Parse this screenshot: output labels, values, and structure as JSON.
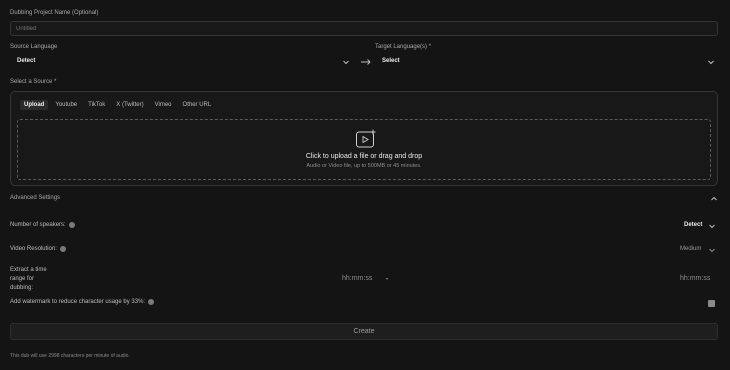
{
  "project_name": {
    "label": "Dubbing Project Name (Optional)",
    "placeholder": "Untitled"
  },
  "source_language": {
    "label": "Source Language",
    "value": "Detect"
  },
  "target_languages": {
    "label": "Target Language(s) *",
    "value": "Select"
  },
  "source": {
    "label": "Select a Source *",
    "tabs": [
      "Upload",
      "Youtube",
      "TikTok",
      "X (Twitter)",
      "Vimeo",
      "Other URL"
    ],
    "upload": {
      "title": "Click to upload a file or drag and drop",
      "subtitle": "Audio or Video file, up to 500MB or 45 minutes."
    }
  },
  "advanced": {
    "title": "Advanced Settings",
    "speakers": {
      "label": "Number of speakers:",
      "value": "Detect"
    },
    "resolution": {
      "label": "Video Resolution:",
      "value": "Medium"
    },
    "time_range": {
      "label_lines": [
        "Extract a time",
        "range for",
        "dubbing:"
      ],
      "start": "hh:mm:ss",
      "end": "hh:mm:ss"
    },
    "watermark": {
      "label": "Add watermark to reduce character usage by 33%:",
      "checked": false
    }
  },
  "create_label": "Create",
  "footer_note": "This dub will use 2998 characters per minute of audio.",
  "colors": {
    "background": "#141414",
    "border": "#353535",
    "accent_text": "#e9e9e9"
  },
  "icons": [
    "chevron-down-icon",
    "arrow-right-icon",
    "upload-video-icon",
    "chevron-up-icon",
    "help-icon"
  ]
}
